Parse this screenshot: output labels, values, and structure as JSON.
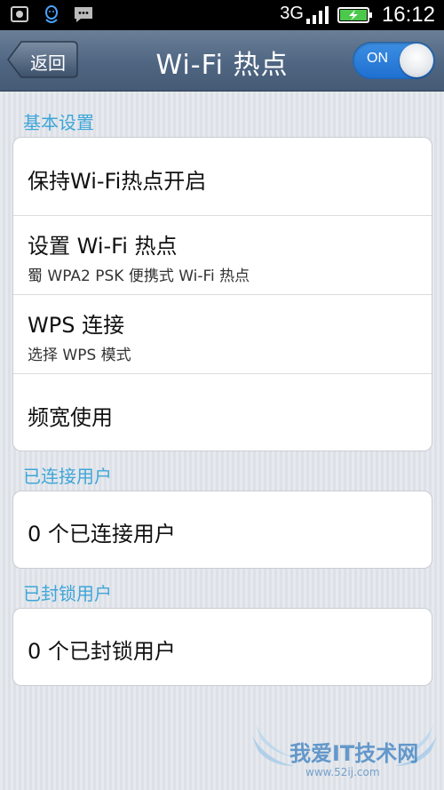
{
  "status_bar": {
    "network_type": "3G",
    "time": "16:12",
    "icons": [
      "screenshot-icon",
      "qq-icon",
      "message-icon",
      "signal-icon",
      "battery-charging-icon"
    ]
  },
  "header": {
    "back_label": "返回",
    "title": "Wi-Fi 热点",
    "toggle_label": "ON"
  },
  "sections": {
    "basic": {
      "header": "基本设置",
      "rows": [
        {
          "title": "保持Wi-Fi热点开启"
        },
        {
          "title": "设置 Wi-Fi 热点",
          "subtitle": "蜀 WPA2 PSK 便携式 Wi-Fi 热点"
        },
        {
          "title": "WPS 连接",
          "subtitle": "选择 WPS 模式"
        },
        {
          "title": "频宽使用"
        }
      ]
    },
    "connected": {
      "header": "已连接用户",
      "row": "0 个已连接用户"
    },
    "blocked": {
      "header": "已封锁用户",
      "row": "0 个已封锁用户"
    }
  },
  "watermark": {
    "text": "我爱IT技术网",
    "url": "www.52ij.com"
  },
  "colors": {
    "section_header": "#3fa6d8",
    "title_bar": "#4f6682",
    "toggle_on": "#1f6fd0"
  }
}
